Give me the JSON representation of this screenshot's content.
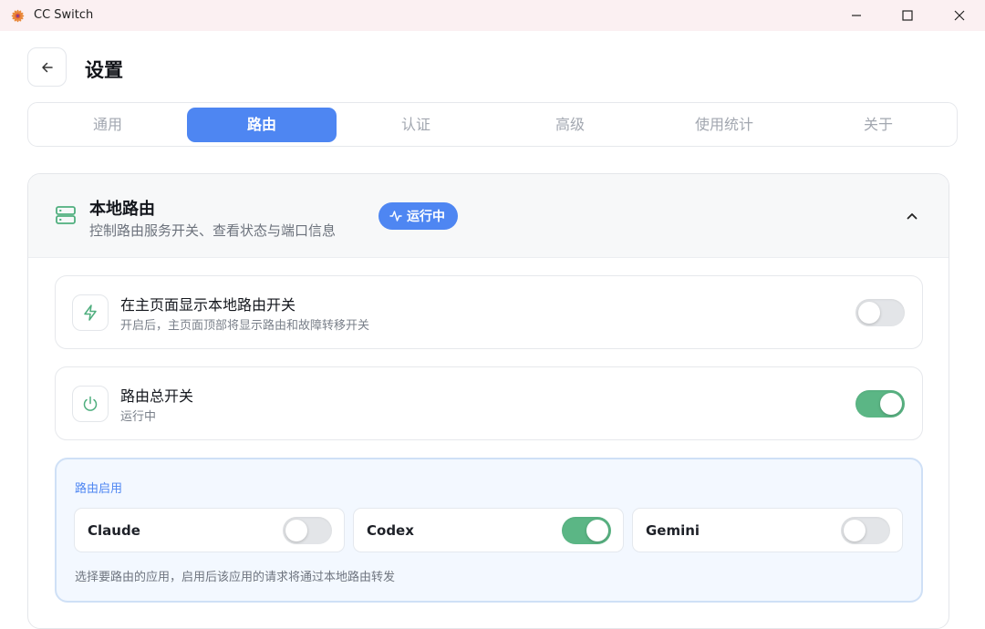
{
  "window": {
    "title": "CC Switch",
    "logo_icon": "cc-switch-logo",
    "controls": [
      "minimize",
      "maximize",
      "close"
    ]
  },
  "header": {
    "back_icon": "arrow-left-icon",
    "title": "设置"
  },
  "tabs": [
    {
      "label": "通用",
      "active": false
    },
    {
      "label": "路由",
      "active": true
    },
    {
      "label": "认证",
      "active": false
    },
    {
      "label": "高级",
      "active": false
    },
    {
      "label": "使用统计",
      "active": false
    },
    {
      "label": "关于",
      "active": false
    }
  ],
  "section": {
    "icon": "server-icon",
    "title": "本地路由",
    "description": "控制路由服务开关、查看状态与端口信息",
    "status_badge": "运行中",
    "status_icon": "activity-icon",
    "collapse_icon": "chevron-up-icon"
  },
  "rows": [
    {
      "icon": "lightning-icon",
      "title": "在主页面显示本地路由开关",
      "description": "开启后，主页面顶部将显示路由和故障转移开关",
      "enabled": false
    },
    {
      "icon": "power-icon",
      "title": "路由总开关",
      "description": "运行中",
      "enabled": true
    }
  ],
  "apps_block": {
    "label": "路由启用",
    "apps": [
      {
        "name": "Claude",
        "enabled": false
      },
      {
        "name": "Codex",
        "enabled": true
      },
      {
        "name": "Gemini",
        "enabled": false
      }
    ],
    "hint": "选择要路由的应用，启用后该应用的请求将通过本地路由转发"
  },
  "colors": {
    "accent": "#4e86f2",
    "toggle_on": "#5bb685",
    "icon_green": "#4fae7e",
    "titlebar": "#fbf0f2"
  }
}
